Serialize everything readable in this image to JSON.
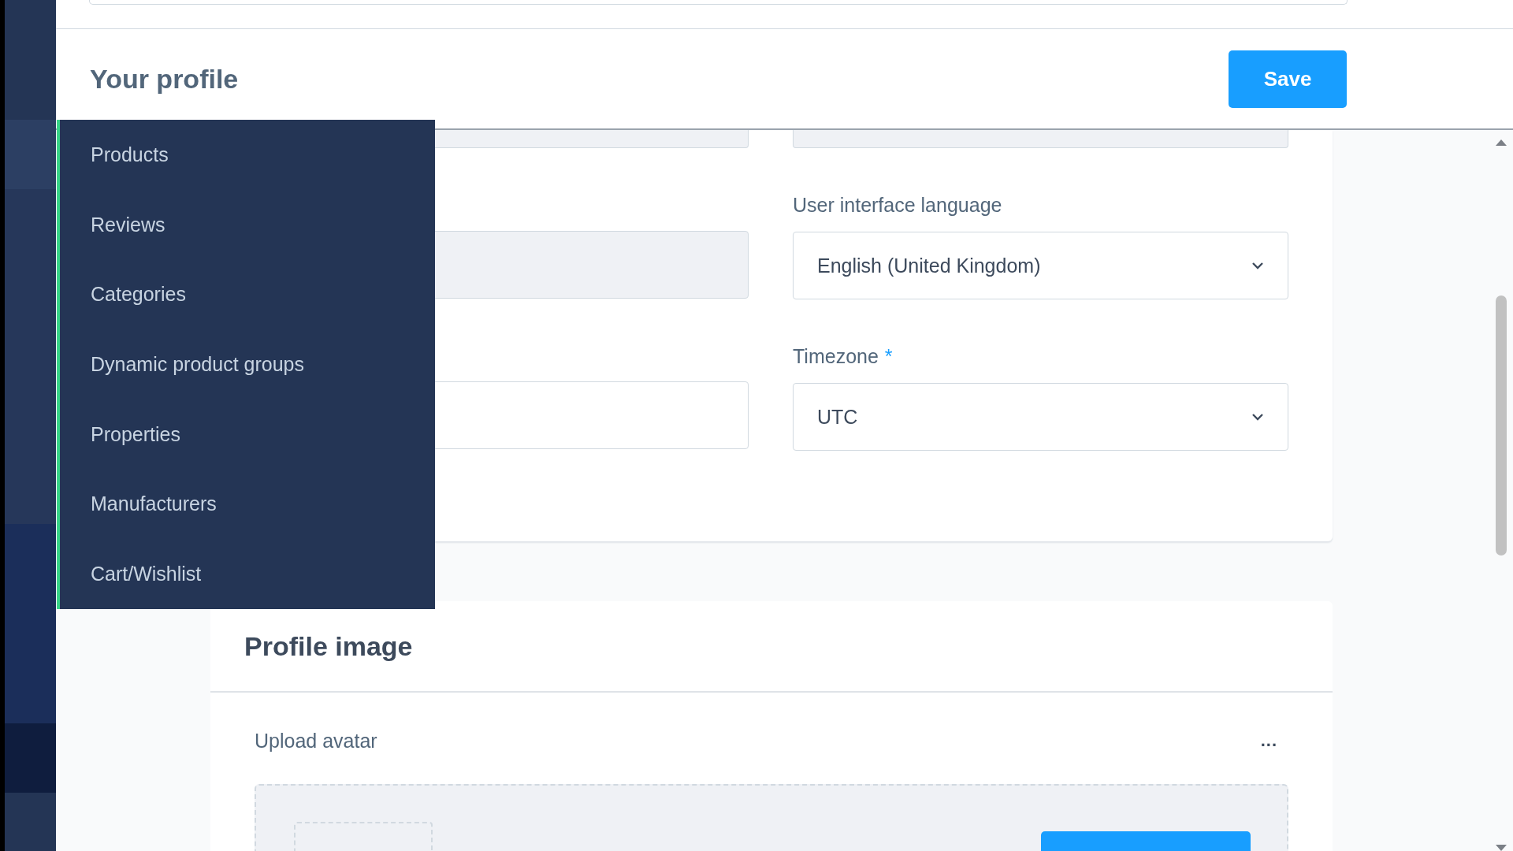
{
  "header": {
    "title": "Your profile",
    "save_button": "Save"
  },
  "flyout_menu": {
    "items": [
      {
        "label": "Products"
      },
      {
        "label": "Reviews"
      },
      {
        "label": "Categories"
      },
      {
        "label": "Dynamic product groups"
      },
      {
        "label": "Properties"
      },
      {
        "label": "Manufacturers"
      },
      {
        "label": "Cart/Wishlist"
      }
    ]
  },
  "settings_card": {
    "fields": [
      {
        "label": "User interface language",
        "value": "English (United Kingdom)"
      },
      {
        "label": "Timezone",
        "required_mark": "*",
        "value": "UTC"
      }
    ]
  },
  "profile_image_card": {
    "title": "Profile image",
    "upload_label": "Upload avatar",
    "more_button": "..."
  }
}
